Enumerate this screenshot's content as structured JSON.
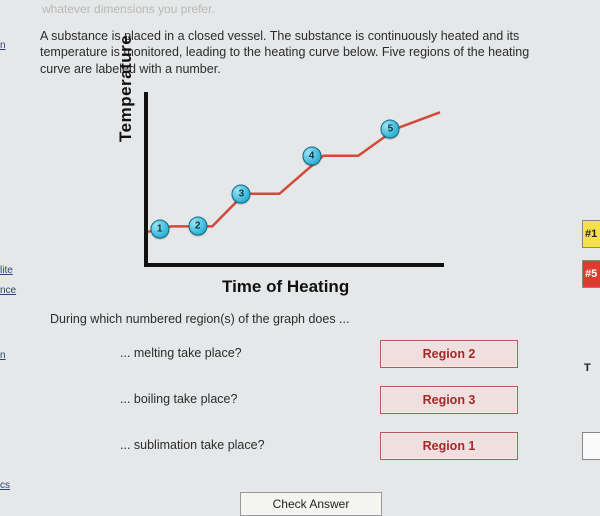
{
  "top_hint": "whatever dimensions you prefer.",
  "question_text": "A substance is placed in a closed vessel. The substance is continuously heated and its temperature is monitored, leading to the heating curve below. Five regions of the heating curve are labeled with a number.",
  "chart_data": {
    "type": "line",
    "title": "",
    "xlabel": "Time of Heating",
    "ylabel": "Temperature",
    "x": [
      0,
      0.8,
      2.2,
      3.3,
      4.5,
      6.0,
      7.2,
      8.5,
      10
    ],
    "y": [
      1.0,
      1.2,
      1.2,
      2.4,
      2.4,
      3.8,
      3.8,
      4.8,
      5.4
    ],
    "xlim": [
      0,
      10
    ],
    "ylim": [
      0,
      6
    ],
    "markers": [
      {
        "label": "1",
        "x": 0.4,
        "y": 1.1
      },
      {
        "label": "2",
        "x": 1.7,
        "y": 1.2
      },
      {
        "label": "3",
        "x": 3.2,
        "y": 2.4
      },
      {
        "label": "4",
        "x": 5.6,
        "y": 3.8
      },
      {
        "label": "5",
        "x": 8.3,
        "y": 4.8
      }
    ],
    "grid": false,
    "legend": false
  },
  "sub_question": "During which numbered region(s) of the graph does ...",
  "prompts": {
    "melting": "... melting take place?",
    "boiling": "... boiling take place?",
    "sublimation": "... sublimation take place?"
  },
  "answers": {
    "melting": "Region 2",
    "boiling": "Region 3",
    "sublimation": "Region 1"
  },
  "check_button": "Check Answer",
  "left_links": {
    "a": "n",
    "b": "lite",
    "c": "nce",
    "d": "n",
    "e": "cs"
  },
  "right_chips": {
    "yellow": "#1",
    "red": "#5",
    "white_letter": "T"
  }
}
